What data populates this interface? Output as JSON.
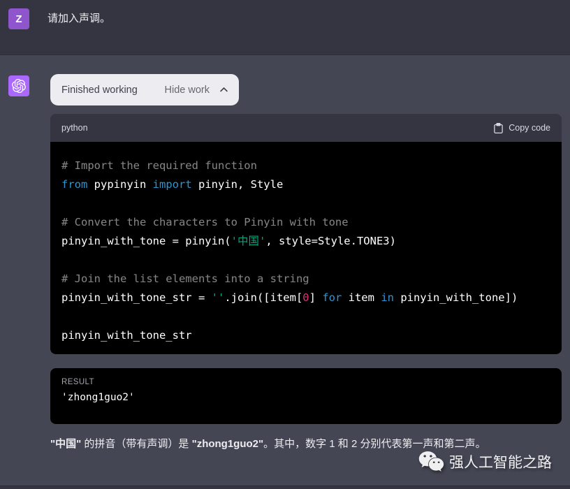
{
  "user_message": {
    "avatar_letter": "Z",
    "text": "请加入声调。"
  },
  "assistant": {
    "work_toggle": {
      "status_label": "Finished working",
      "toggle_label": "Hide work",
      "chevron": "chevron-up"
    },
    "code_block": {
      "language": "python",
      "copy_label": "Copy code",
      "lines": [
        {
          "tokens": [
            {
              "t": "# Import the required function",
              "c": "comment"
            }
          ]
        },
        {
          "tokens": [
            {
              "t": "from",
              "c": "keyword"
            },
            {
              "t": " pypinyin ",
              "c": "plain"
            },
            {
              "t": "import",
              "c": "keyword"
            },
            {
              "t": " pinyin, Style",
              "c": "plain"
            }
          ]
        },
        {
          "tokens": []
        },
        {
          "tokens": [
            {
              "t": "# Convert the characters to Pinyin with tone",
              "c": "comment"
            }
          ]
        },
        {
          "tokens": [
            {
              "t": "pinyin_with_tone = pinyin(",
              "c": "plain"
            },
            {
              "t": "'中国'",
              "c": "string"
            },
            {
              "t": ", style=Style.TONE3)",
              "c": "plain"
            }
          ]
        },
        {
          "tokens": []
        },
        {
          "tokens": [
            {
              "t": "# Join the list elements into a string",
              "c": "comment"
            }
          ]
        },
        {
          "tokens": [
            {
              "t": "pinyin_with_tone_str = ",
              "c": "plain"
            },
            {
              "t": "''",
              "c": "string"
            },
            {
              "t": ".join([item[",
              "c": "plain"
            },
            {
              "t": "0",
              "c": "number"
            },
            {
              "t": "] ",
              "c": "plain"
            },
            {
              "t": "for",
              "c": "keyword"
            },
            {
              "t": " item ",
              "c": "plain"
            },
            {
              "t": "in",
              "c": "keyword"
            },
            {
              "t": " pinyin_with_tone])",
              "c": "plain"
            }
          ]
        },
        {
          "tokens": []
        },
        {
          "tokens": [
            {
              "t": "pinyin_with_tone_str",
              "c": "plain"
            }
          ]
        }
      ]
    },
    "result_block": {
      "label": "RESULT",
      "value": "'zhong1guo2'"
    },
    "answer": {
      "segments": [
        {
          "text": "\"中国\"",
          "bold": true
        },
        {
          "text": " 的拼音（带有声调）是 ",
          "bold": false
        },
        {
          "text": "\"zhong1guo2\"",
          "bold": true
        },
        {
          "text": "。其中，数字 1 和 2 分别代表第一声和第二声。",
          "bold": false
        }
      ]
    }
  },
  "watermark": {
    "icon": "wechat-icon",
    "text": "强人工智能之路"
  },
  "colors": {
    "page_bg": "#343541",
    "assistant_bg": "#444654",
    "user_avatar_bg": "#8e55cc",
    "assistant_avatar_bg": "#ab68ff",
    "pill_bg": "#ececf1",
    "code_bg": "#000000",
    "code_header_bg": "#343541",
    "syntax": {
      "keyword": "#2e95d3",
      "string": "#00a67d",
      "number": "#df3079",
      "comment": "rgba(255,255,255,0.52)",
      "plain": "#ffffff"
    }
  }
}
